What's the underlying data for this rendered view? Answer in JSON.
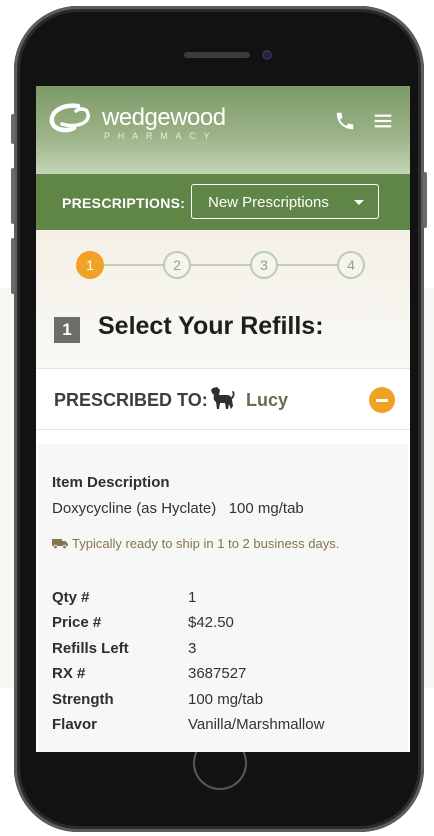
{
  "header": {
    "logo_word": "wedgewood",
    "logo_sub": "PHARMACY",
    "icons": [
      "phone-icon",
      "menu-icon"
    ],
    "colors": {
      "header_green": "#7e9a68",
      "bar_green": "#5f8547",
      "accent_orange": "#f0a227"
    }
  },
  "prescriptions_bar": {
    "label": "PRESCRIPTIONS:",
    "selected": "New Prescriptions"
  },
  "steps": [
    "1",
    "2",
    "3",
    "4"
  ],
  "active_step": 1,
  "section": {
    "number": "1",
    "title": "Select Your Refills:"
  },
  "prescribed": {
    "label": "PRESCRIBED TO:",
    "pet_name": "Lucy"
  },
  "item": {
    "description_label": "Item Description",
    "description": "Doxycycline (as Hyclate)   100 mg/tab",
    "shipping_note": "Typically ready to ship in 1 to 2 business days.",
    "details": [
      {
        "label": "Qty #",
        "value": "1"
      },
      {
        "label": "Price #",
        "value": "$42.50"
      },
      {
        "label": "Refills Left",
        "value": "3"
      },
      {
        "label": "RX #",
        "value": "3687527"
      },
      {
        "label": "Strength",
        "value": "100 mg/tab"
      },
      {
        "label": "Flavor",
        "value": "Vanilla/Marshmallow"
      }
    ]
  }
}
